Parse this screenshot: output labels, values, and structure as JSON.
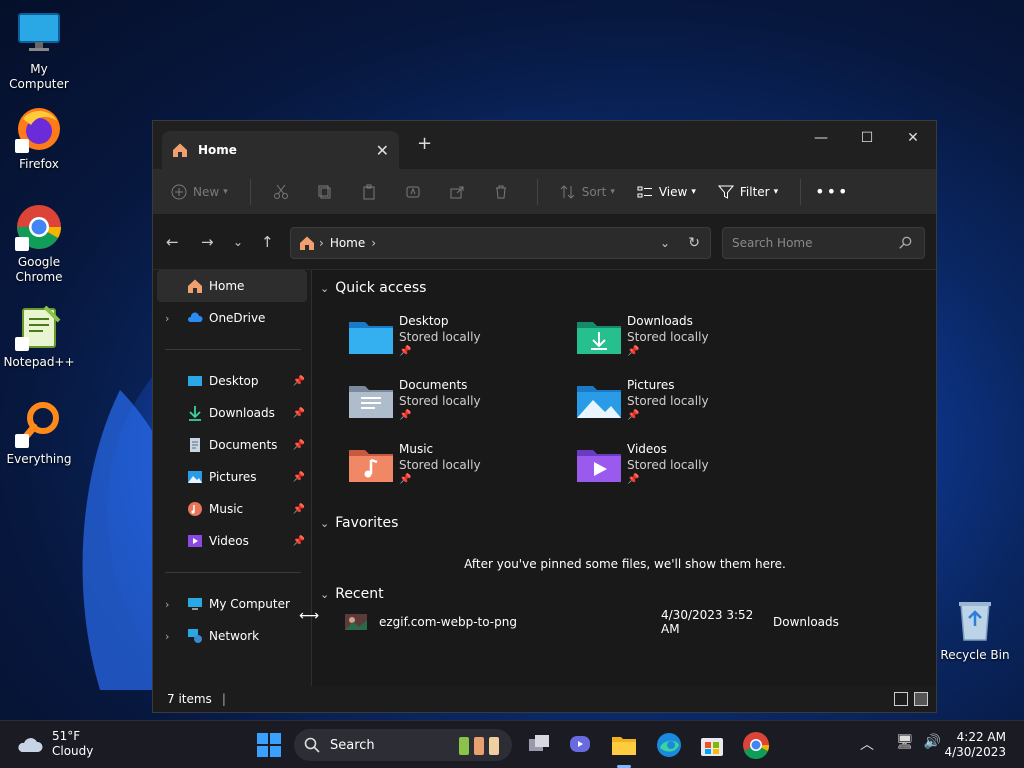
{
  "desktop": {
    "icons": [
      {
        "label": "My Computer"
      },
      {
        "label": "Firefox"
      },
      {
        "label": "Google Chrome"
      },
      {
        "label": "Notepad++"
      },
      {
        "label": "Everything"
      },
      {
        "label": "Recycle Bin"
      }
    ]
  },
  "explorer": {
    "tab_title": "Home",
    "toolbar": {
      "new": "New",
      "sort": "Sort",
      "view": "View",
      "filter": "Filter"
    },
    "address": {
      "crumb": "Home",
      "search_placeholder": "Search Home"
    },
    "sidebar": {
      "top": [
        {
          "label": "Home"
        },
        {
          "label": "OneDrive"
        }
      ],
      "pinned": [
        {
          "label": "Desktop"
        },
        {
          "label": "Downloads"
        },
        {
          "label": "Documents"
        },
        {
          "label": "Pictures"
        },
        {
          "label": "Music"
        },
        {
          "label": "Videos"
        }
      ],
      "bottom": [
        {
          "label": "My Computer"
        },
        {
          "label": "Network"
        }
      ]
    },
    "quick_access": {
      "heading": "Quick access",
      "items": [
        {
          "name": "Desktop",
          "sub": "Stored locally"
        },
        {
          "name": "Downloads",
          "sub": "Stored locally"
        },
        {
          "name": "Documents",
          "sub": "Stored locally"
        },
        {
          "name": "Pictures",
          "sub": "Stored locally"
        },
        {
          "name": "Music",
          "sub": "Stored locally"
        },
        {
          "name": "Videos",
          "sub": "Stored locally"
        }
      ]
    },
    "favorites": {
      "heading": "Favorites",
      "empty_text": "After you've pinned some files, we'll show them here."
    },
    "recent": {
      "heading": "Recent",
      "items": [
        {
          "name": "ezgif.com-webp-to-png",
          "date": "4/30/2023 3:52 AM",
          "location": "Downloads"
        }
      ]
    },
    "status": "7 items"
  },
  "taskbar": {
    "weather_temp": "51°F",
    "weather_desc": "Cloudy",
    "search_label": "Search",
    "time": "4:22 AM",
    "date": "4/30/2023"
  }
}
